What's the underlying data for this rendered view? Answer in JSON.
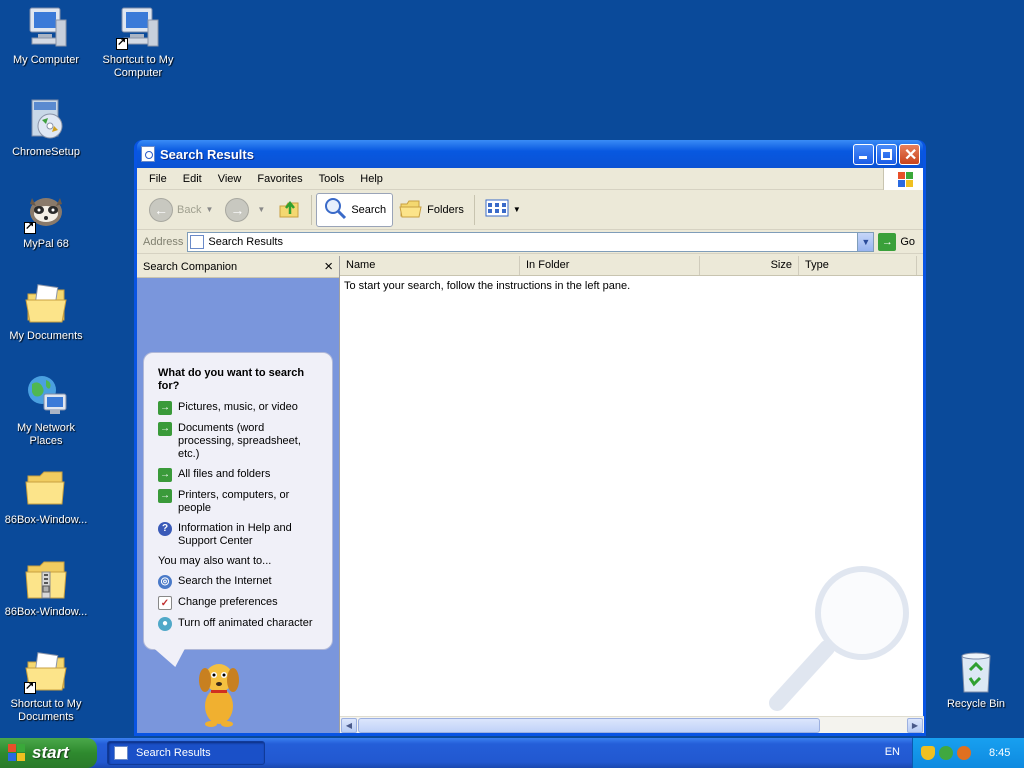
{
  "desktop": {
    "icons": [
      {
        "label": "My Computer"
      },
      {
        "label": "Shortcut to My Computer"
      },
      {
        "label": "ChromeSetup"
      },
      {
        "label": "MyPal 68"
      },
      {
        "label": "My Documents"
      },
      {
        "label": "My Network Places"
      },
      {
        "label": "86Box-Window..."
      },
      {
        "label": "86Box-Window..."
      },
      {
        "label": "Shortcut to My Documents"
      },
      {
        "label": "Recycle Bin"
      }
    ]
  },
  "window": {
    "title": "Search Results",
    "menu": [
      "File",
      "Edit",
      "View",
      "Favorites",
      "Tools",
      "Help"
    ],
    "toolbar": {
      "back": "Back",
      "search": "Search",
      "folders": "Folders"
    },
    "address": {
      "label": "Address",
      "value": "Search Results",
      "go": "Go"
    },
    "companion": {
      "header": "Search Companion",
      "close": "×",
      "question": "What do you want to search for?",
      "options": [
        "Pictures, music, or video",
        "Documents (word processing, spreadsheet, etc.)",
        "All files and folders",
        "Printers, computers, or people",
        "Information in Help and Support Center"
      ],
      "also_label": "You may also want to...",
      "also": [
        "Search the Internet",
        "Change preferences",
        "Turn off animated character"
      ]
    },
    "results": {
      "columns": [
        "Name",
        "In Folder",
        "Size",
        "Type"
      ],
      "empty_message": "To start your search, follow the instructions in the left pane."
    }
  },
  "taskbar": {
    "start": "start",
    "task": "Search Results",
    "language": "EN",
    "clock": "8:45"
  },
  "colors": {
    "desktop": "#0a4a9a",
    "titlebar": "#0854e3",
    "pane": "#7a96dc",
    "start": "#2e8a2e"
  }
}
